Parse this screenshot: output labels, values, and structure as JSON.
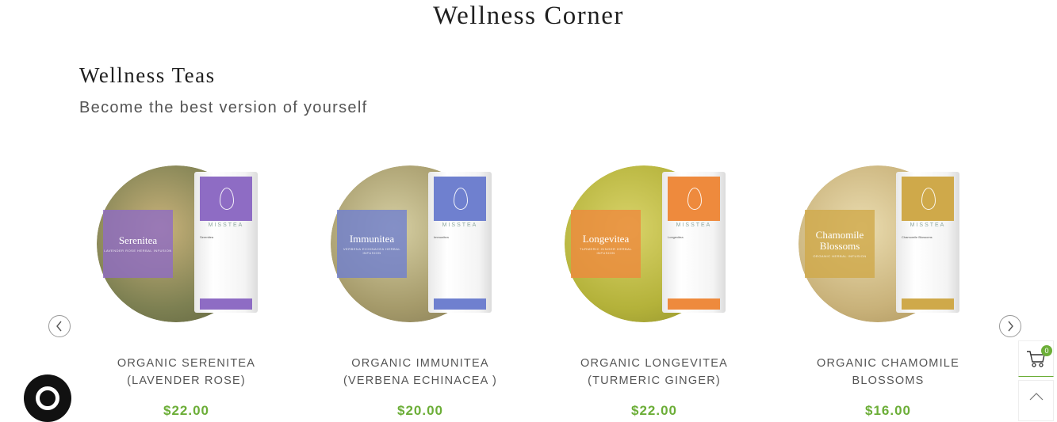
{
  "page": {
    "title": "Wellness Corner"
  },
  "section": {
    "title": "Wellness Teas",
    "subtitle": "Become the best version of yourself"
  },
  "products": [
    {
      "name_line1": "ORGANIC SERENITEA",
      "name_line2": "(LAVENDER ROSE)",
      "price": "$22.00",
      "label_name": "Serenitea",
      "label_sub": "LAVENDER ROSE HERBAL INFUSION",
      "tin_brand": "MISSTEA",
      "color": "#8e6cc4",
      "bowl_color": "#8a8f5a"
    },
    {
      "name_line1": "ORGANIC IMMUNITEA",
      "name_line2": "(VERBENA ECHINACEA )",
      "price": "$20.00",
      "label_name": "Immunitea",
      "label_sub": "VERBENA ECHINACEA HERBAL INFUSION",
      "tin_brand": "MISSTEA",
      "color": "#6f80cf",
      "bowl_color": "#a59a6a"
    },
    {
      "name_line1": "ORGANIC LONGEVITEA",
      "name_line2": "(TURMERIC GINGER)",
      "price": "$22.00",
      "label_name": "Longevitea",
      "label_sub": "TURMERIC GINGER HERBAL INFUSION",
      "tin_brand": "MISSTEA",
      "color": "#ee8a3d",
      "bowl_color": "#b4b23a"
    },
    {
      "name_line1": "ORGANIC CHAMOMILE",
      "name_line2": "BLOSSOMS",
      "price": "$16.00",
      "label_name": "Chamomile Blossoms",
      "label_sub": "ORGANIC HERBAL INFUSION",
      "tin_brand": "MISSTEA",
      "color": "#cfa94a",
      "bowl_color": "#c9b27a"
    }
  ],
  "cart": {
    "count": "0"
  },
  "colors": {
    "accent": "#6cae38"
  },
  "icons": {
    "prev": "chevron-left-icon",
    "next": "chevron-right-icon",
    "cart": "cart-icon",
    "top": "chevron-up-icon",
    "chat": "chat-icon"
  }
}
